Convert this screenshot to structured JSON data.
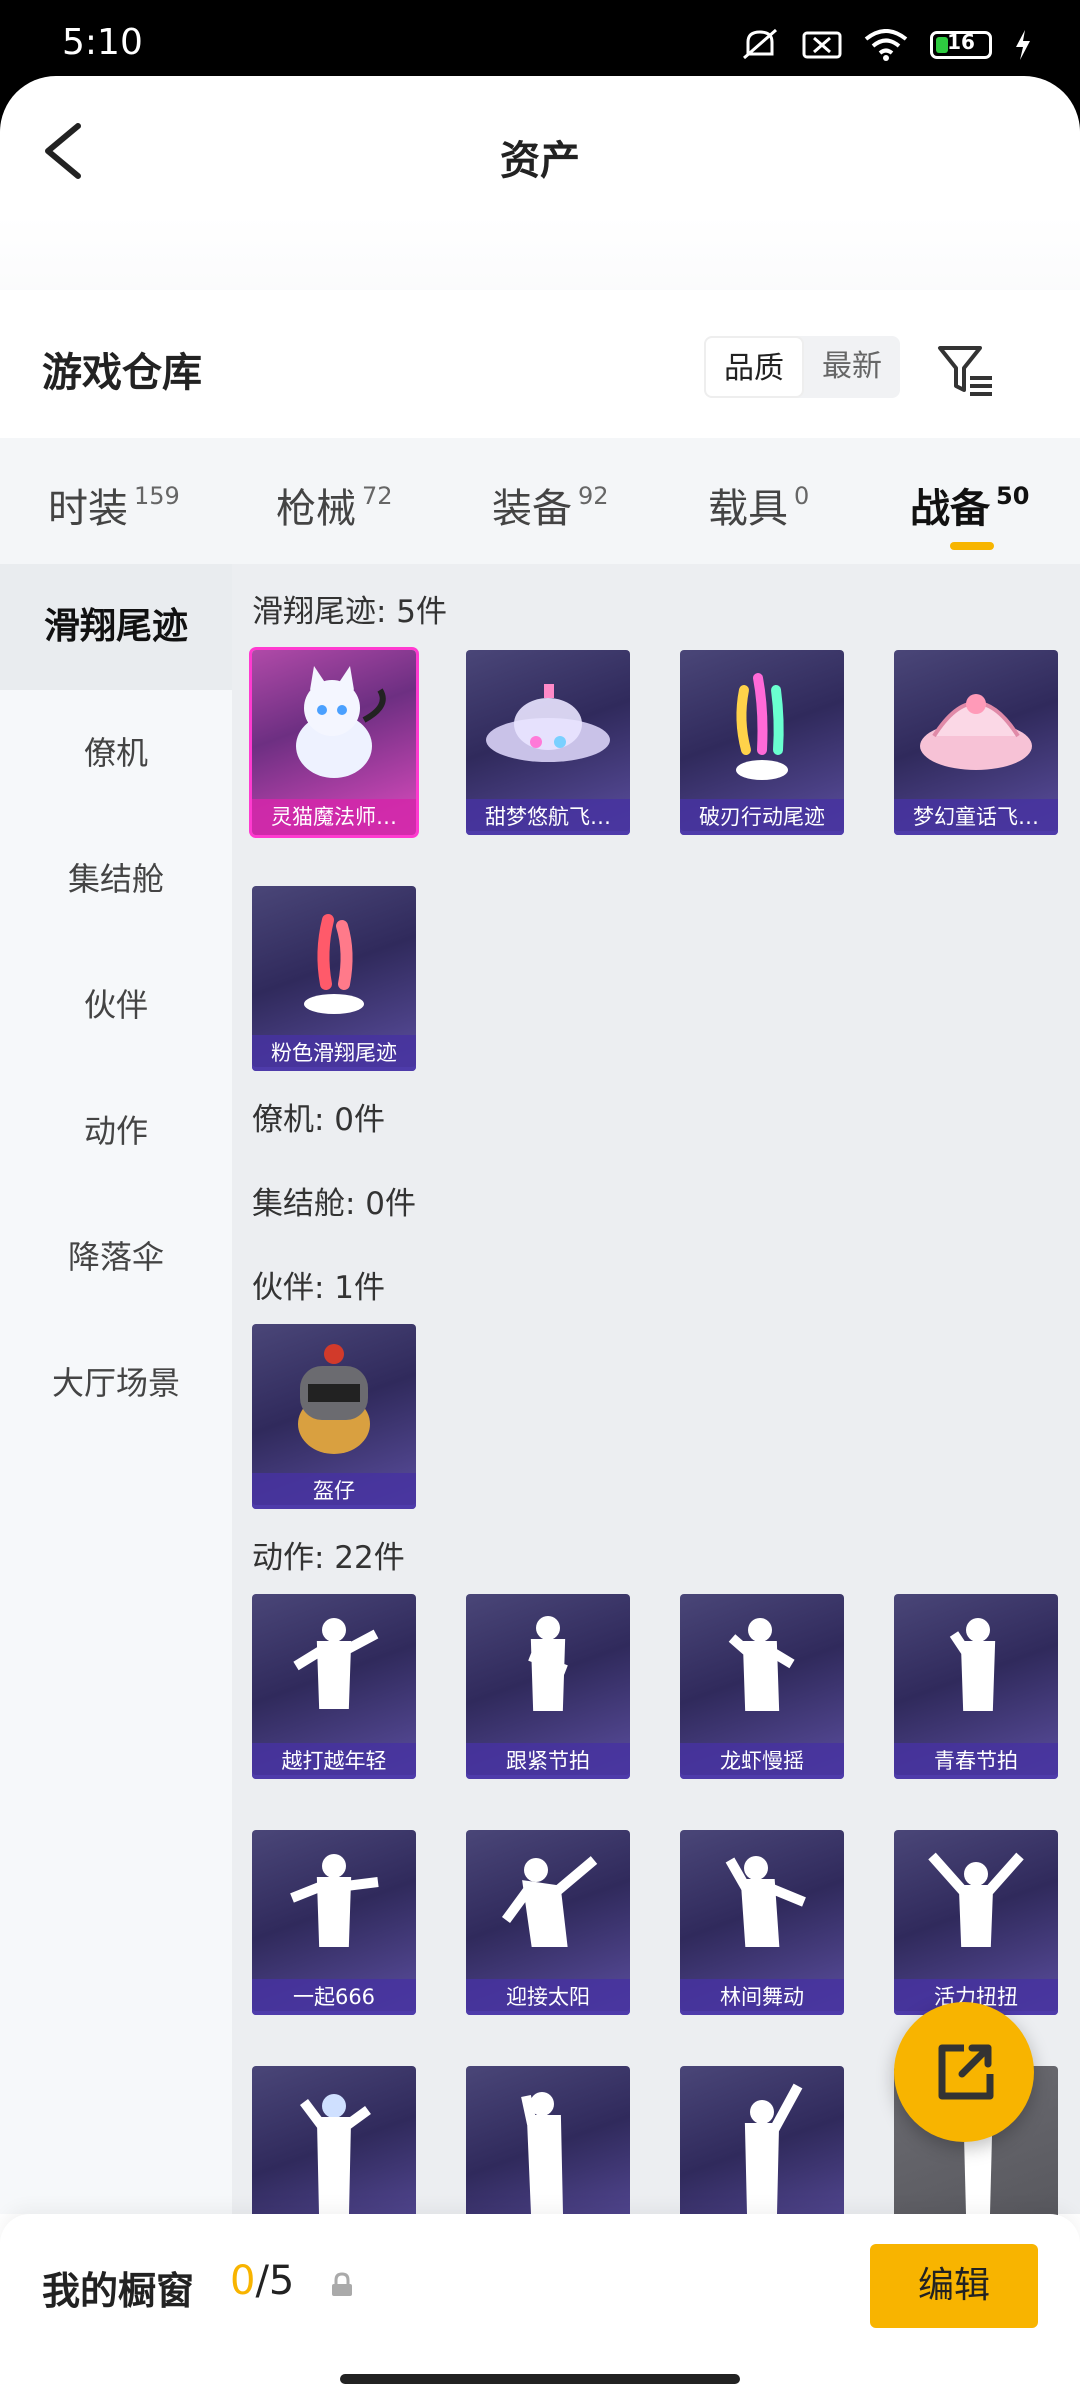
{
  "status": {
    "time": "5:10",
    "battery": "16"
  },
  "nav": {
    "title": "资产"
  },
  "warehouse": {
    "title": "游戏仓库",
    "sort_options": [
      "品质",
      "最新"
    ],
    "active_sort": "品质"
  },
  "tabs": [
    {
      "label": "时装",
      "count": "159"
    },
    {
      "label": "枪械",
      "count": "72"
    },
    {
      "label": "装备",
      "count": "92"
    },
    {
      "label": "载具",
      "count": "0"
    },
    {
      "label": "战备",
      "count": "50",
      "active": true
    }
  ],
  "sidebar": {
    "items": [
      {
        "label": "滑翔尾迹",
        "active": true
      },
      {
        "label": "僚机"
      },
      {
        "label": "集结舱"
      },
      {
        "label": "伙伴"
      },
      {
        "label": "动作"
      },
      {
        "label": "降落伞"
      },
      {
        "label": "大厅场景"
      }
    ]
  },
  "sections": {
    "glide": {
      "title": "滑翔尾迹: 5件",
      "items": [
        "灵猫魔法师…",
        "甜梦悠航飞…",
        "破刃行动尾迹",
        "梦幻童话飞…",
        "粉色滑翔尾迹"
      ]
    },
    "wingman": {
      "title": "僚机: 0件"
    },
    "capsule": {
      "title": "集结舱: 0件"
    },
    "partner": {
      "title": "伙伴: 1件",
      "items": [
        "盔仔"
      ]
    },
    "action": {
      "title": "动作: 22件",
      "items": [
        "越打越年轻",
        "跟紧节拍",
        "龙虾慢摇",
        "青春节拍",
        "一起666",
        "迎接太阳",
        "林间舞动",
        "活力扭扭"
      ]
    }
  },
  "bottom": {
    "title": "我的橱窗",
    "count_current": "0",
    "count_total": "/5",
    "edit_label": "编辑"
  },
  "colors": {
    "accent": "#f8b400",
    "card_pink": "#ff3ad0",
    "card_purple": "#5c4fa0"
  }
}
